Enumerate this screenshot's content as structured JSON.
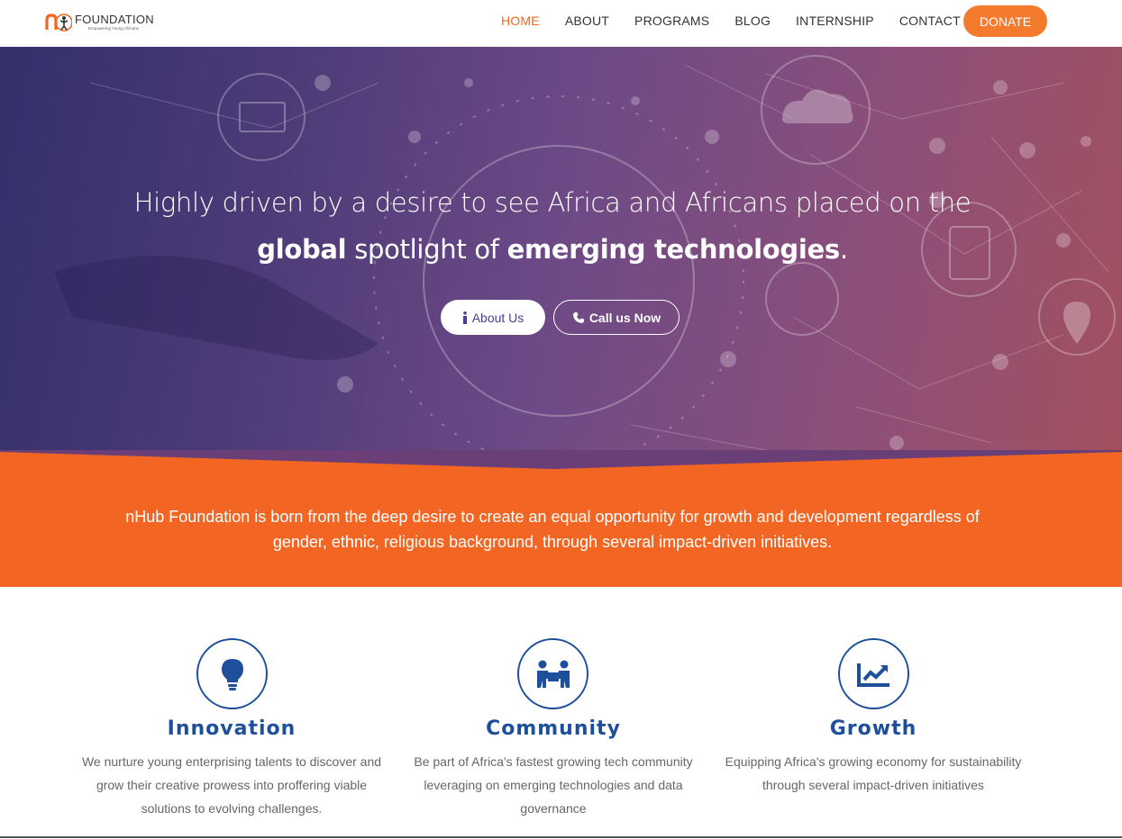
{
  "header": {
    "logo_text": "FOUNDATION",
    "logo_tagline": "Empowering Young Africans",
    "nav": [
      {
        "label": "HOME"
      },
      {
        "label": "ABOUT"
      },
      {
        "label": "PROGRAMS"
      },
      {
        "label": "BLOG"
      },
      {
        "label": "INTERNSHIP"
      },
      {
        "label": "CONTACT"
      }
    ],
    "donate_label": "DONATE"
  },
  "hero": {
    "line1": "Highly driven by a desire to see Africa and Africans  placed on the",
    "line2_bold1": "global",
    "line2_mid": " spotlight of ",
    "line2_bold2": "emerging technologies",
    "line2_end": ".",
    "about_label": "About Us",
    "call_label": "Call us Now"
  },
  "band": {
    "text": "nHub Foundation is born from the deep desire to create an equal opportunity for growth and development regardless of gender, ethnic, religious background, through several impact-driven initiatives."
  },
  "features": [
    {
      "icon": "lightbulb-icon",
      "title": "Innovation",
      "desc": "We nurture young enterprising talents to discover and grow their creative prowess into proffering viable solutions to evolving challenges."
    },
    {
      "icon": "community-icon",
      "title": "Community",
      "desc": "Be part of Africa's fastest growing tech community leveraging on emerging technologies and data governance"
    },
    {
      "icon": "growth-chart-icon",
      "title": "Growth",
      "desc": "Equipping Africa's growing economy for sustainability through several impact-driven initiatives"
    }
  ],
  "colors": {
    "accent_orange": "#f26522",
    "donate_orange": "#f47b2e",
    "brand_blue": "#1e4f9b"
  }
}
